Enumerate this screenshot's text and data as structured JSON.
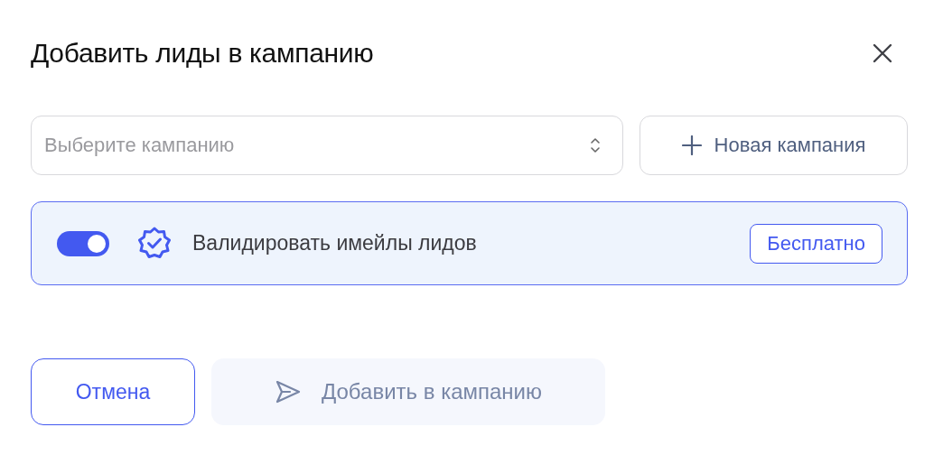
{
  "dialog": {
    "title": "Добавить лиды в кампанию"
  },
  "campaign_select": {
    "placeholder": "Выберите кампанию"
  },
  "new_campaign_button": {
    "label": "Новая кампания"
  },
  "validation": {
    "on": true,
    "label": "Валидировать имейлы лидов",
    "badge": "Бесплатно"
  },
  "buttons": [
    {
      "kind": "cancel",
      "label": "Отмена"
    },
    {
      "kind": "submit",
      "label": "Добавить в кампанию",
      "disabled": true
    }
  ]
}
